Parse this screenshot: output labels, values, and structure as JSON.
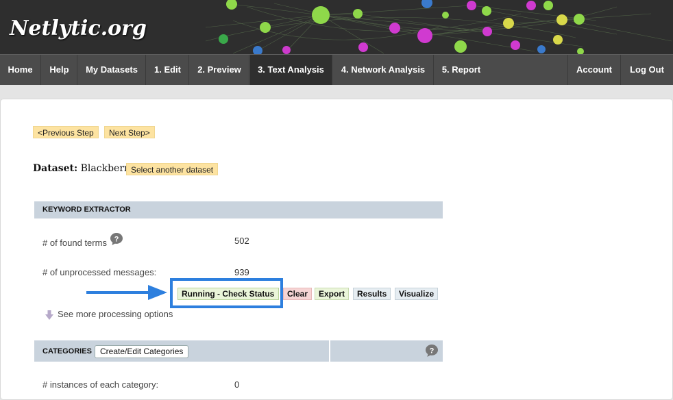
{
  "app": {
    "logo": "Netlytic.org"
  },
  "nav": {
    "items": [
      {
        "label": "Home"
      },
      {
        "label": "Help"
      },
      {
        "label": "My Datasets"
      },
      {
        "label": "1. Edit"
      },
      {
        "label": "2. Preview"
      },
      {
        "label": "3. Text Analysis",
        "active": true
      },
      {
        "label": "4. Network Analysis"
      },
      {
        "label": "5. Report"
      },
      {
        "label": "Account"
      },
      {
        "label": "Log Out"
      }
    ]
  },
  "steps": {
    "previous": "<Previous Step",
    "next": "Next Step>"
  },
  "dataset": {
    "label": "Dataset:",
    "name": "Blackberry",
    "select_button": "Select another dataset"
  },
  "keyword_extractor": {
    "title": "KEYWORD EXTRACTOR",
    "found_terms_label": "# of found terms",
    "found_terms_value": "502",
    "unprocessed_label": "# of unprocessed messages:",
    "unprocessed_value": "939",
    "buttons": {
      "running": "Running - Check Status",
      "clear": "Clear",
      "export": "Export",
      "results": "Results",
      "visualize": "Visualize"
    },
    "more_options": "See more processing options"
  },
  "categories": {
    "title": "CATEGORIES",
    "create_button": "Create/Edit Categories",
    "instances_label": "# instances of each category:",
    "instances_value": "0"
  },
  "colors": {
    "header_bg": "#2e2e2e",
    "nav_bg": "#4b4b4b",
    "nav_active": "#2f2f2f",
    "section_bar": "#c9d3dd",
    "yellow_button": "#fde3a1",
    "highlight": "#2d7fde"
  }
}
